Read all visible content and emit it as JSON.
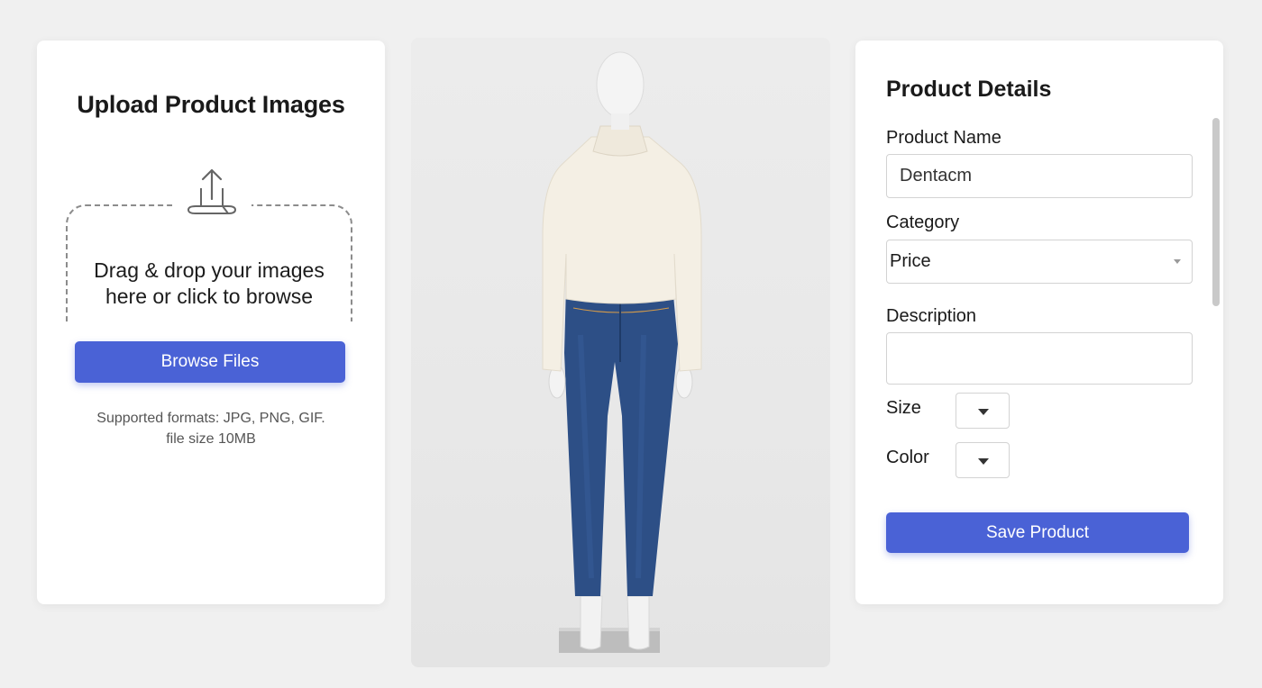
{
  "upload": {
    "title": "Upload Product Images",
    "drop_text_line1": "Drag & drop your images",
    "drop_text_line2": "here or click to browse",
    "browse_label": "Browse Files",
    "formats_line1": "Supported formats: JPG, PNG, GIF.",
    "formats_line2": "file size 10MB",
    "icon": "upload-icon"
  },
  "preview": {
    "icon": "product-photo"
  },
  "details": {
    "title": "Product Details",
    "name_label": "Product Name",
    "name_value": "Dentacm",
    "category_label": "Category",
    "category_value": "Price",
    "description_label": "Description",
    "description_value": "",
    "size_label": "Size",
    "color_label": "Color",
    "save_label": "Save Product"
  },
  "colors": {
    "accent": "#4a62d6",
    "background": "#f0f0f0",
    "card": "#ffffff"
  }
}
